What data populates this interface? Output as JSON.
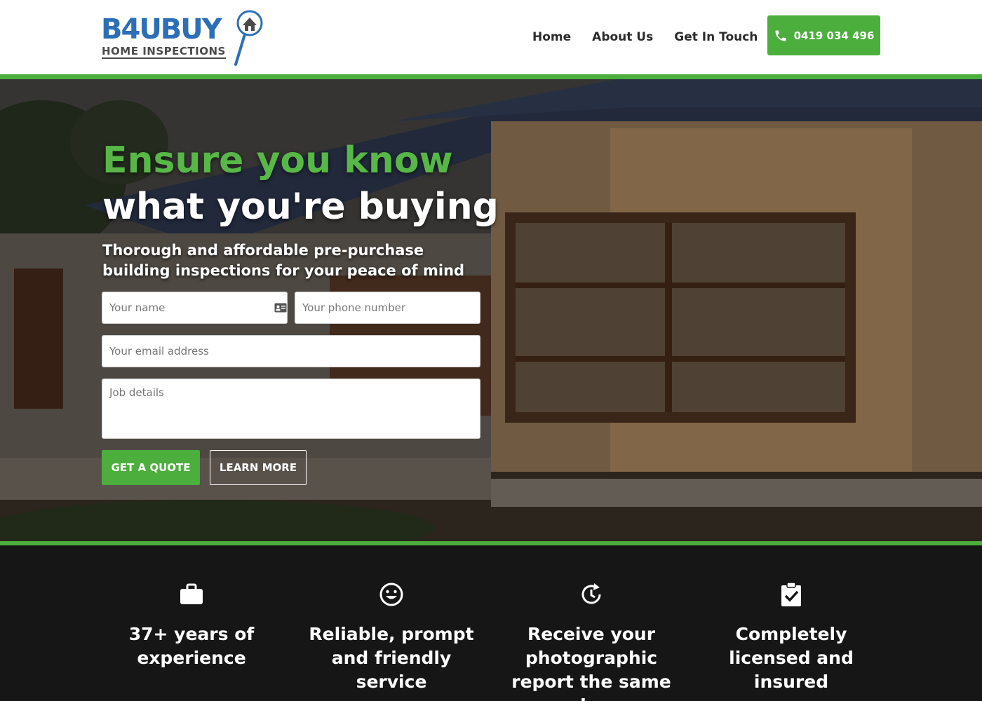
{
  "brand": {
    "logo_word": "B4UBUY",
    "logo_sub": "HOME INSPECTIONS",
    "accent_color": "#4cae3c",
    "logo_color": "#2d6fb7"
  },
  "nav": {
    "items": [
      {
        "label": "Home"
      },
      {
        "label": "About Us"
      },
      {
        "label": "Get In Touch"
      }
    ],
    "phone": "0419 034 496"
  },
  "hero": {
    "title_line1": "Ensure you know",
    "title_line2": "what you're buying",
    "subtitle": "Thorough and affordable pre-purchase building inspections for your peace of mind",
    "form": {
      "name_placeholder": "Your name",
      "phone_placeholder": "Your phone number",
      "email_placeholder": "Your email address",
      "job_placeholder": "Job details"
    },
    "quote_label": "GET A QUOTE",
    "learn_label": "LEARN MORE"
  },
  "features": [
    {
      "icon": "briefcase-icon",
      "text": "37+ years of experience"
    },
    {
      "icon": "smiley-icon",
      "text": "Reliable, prompt and friendly service"
    },
    {
      "icon": "clock-refresh-icon",
      "text": "Receive your photographic report the same day"
    },
    {
      "icon": "clipboard-check-icon",
      "text": "Completely licensed and insured"
    }
  ]
}
